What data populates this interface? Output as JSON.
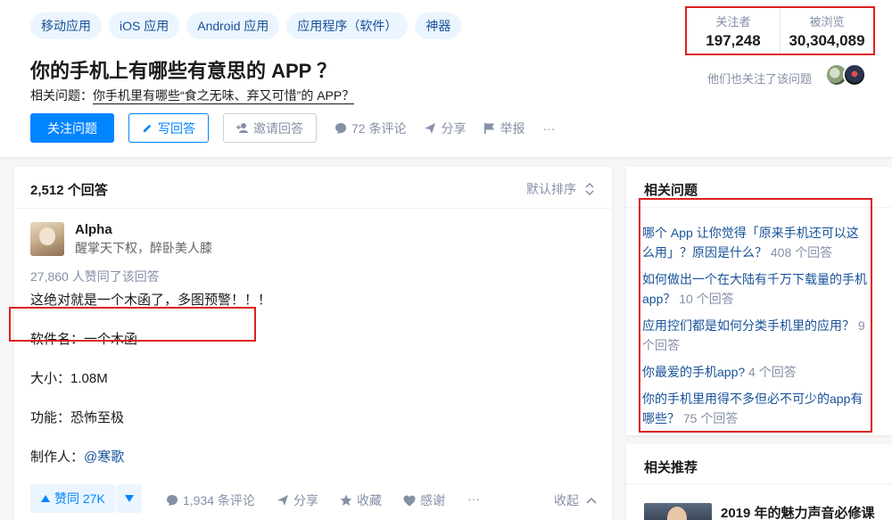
{
  "topics": [
    "移动应用",
    "iOS 应用",
    "Android 应用",
    "应用程序（软件）",
    "神器"
  ],
  "question": {
    "title": "你的手机上有哪些有意思的 APP ？",
    "related_prefix": "相关问题：",
    "related_link": "你手机里有哪些“食之无味、弃又可惜”的 APP？"
  },
  "actions": {
    "follow": "关注问题",
    "write": "写回答",
    "invite": "邀请回答",
    "comments": "72 条评论",
    "share": "分享",
    "report": "举报",
    "more": "···"
  },
  "stats": {
    "followers_label": "关注者",
    "followers": "197,248",
    "views_label": "被浏览",
    "views": "30,304,089",
    "also_follow": "他们也关注了该问题"
  },
  "answers": {
    "count": "2,512 个回答",
    "sort": "默认排序"
  },
  "answer": {
    "author": "Alpha",
    "bio": "醒掌天下权，醉卧美人膝",
    "voters": "27,860 人赞同了该回答",
    "lines": [
      "这绝对就是一个木函了，多图预警！！！",
      "软件名：一个木函",
      "大小：1.08M",
      "功能：恐怖至极"
    ],
    "maker_prefix": "制作人：",
    "maker_mention": "@寒歌"
  },
  "answer_actions": {
    "upvote": "赞同 27K",
    "comments": "1,934 条评论",
    "share": "分享",
    "collect": "收藏",
    "thanks": "感谢",
    "more": "···",
    "collapse": "收起"
  },
  "sidebar": {
    "related_title": "相关问题",
    "related": [
      {
        "text": "哪个 App 让你觉得「原来手机还可以这么用」？原因是什么？",
        "count": "408 个回答"
      },
      {
        "text": "如何做出一个在大陆有千万下载量的手机app？",
        "count": "10 个回答"
      },
      {
        "text": "应用控们都是如何分类手机里的应用？",
        "count": "9 个回答"
      },
      {
        "text": "你最爱的手机app?",
        "count": "4 个回答"
      },
      {
        "text": "你的手机里用得不多但必不可少的app有哪些？",
        "count": "75 个回答"
      }
    ],
    "recommend_title": "相关推荐",
    "recommend_item": "2019 年的魅力声音必修课"
  },
  "colors": {
    "brand": "#0084ff",
    "link": "#175199",
    "muted": "#8590a6",
    "highlight": "#e02020"
  }
}
